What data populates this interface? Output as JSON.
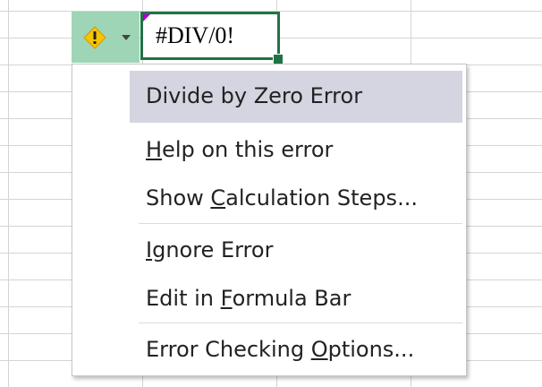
{
  "cell": {
    "value": "#DIV/0!"
  },
  "error_button": {
    "icon": "warning-icon",
    "accent": "#9fd5b7"
  },
  "menu": {
    "header": "Divide by Zero Error",
    "items": [
      {
        "label": "Help on this error",
        "hotkey": "H"
      },
      {
        "label": "Show Calculation Steps...",
        "hotkey": "C"
      },
      {
        "label": "Ignore Error",
        "hotkey": "I"
      },
      {
        "label": "Edit in Formula Bar",
        "hotkey": "F"
      },
      {
        "label": "Error Checking Options...",
        "hotkey": "O"
      }
    ]
  },
  "colors": {
    "selection": "#217346",
    "header_bg": "#d5d5e1",
    "comment_marker": "#b000d0"
  }
}
